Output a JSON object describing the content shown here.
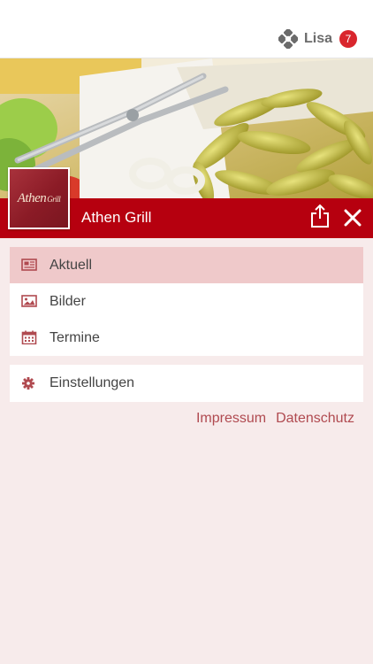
{
  "header": {
    "user_name": "Lisa",
    "notification_count": "7"
  },
  "restaurant": {
    "title": "Athen Grill",
    "logo_text": "Athen",
    "logo_sub": "Grill"
  },
  "menu": {
    "items": [
      {
        "label": "Aktuell",
        "icon": "newspaper-icon",
        "active": true
      },
      {
        "label": "Bilder",
        "icon": "image-icon",
        "active": false
      },
      {
        "label": "Termine",
        "icon": "calendar-icon",
        "active": false
      }
    ],
    "settings": {
      "label": "Einstellungen",
      "icon": "gear-icon"
    }
  },
  "footer": {
    "impressum": "Impressum",
    "datenschutz": "Datenschutz"
  },
  "colors": {
    "accent": "#b6000f",
    "badge": "#d9262d",
    "background": "#f7ebeb",
    "active_item": "#efc9ca",
    "link": "#b04a50"
  }
}
